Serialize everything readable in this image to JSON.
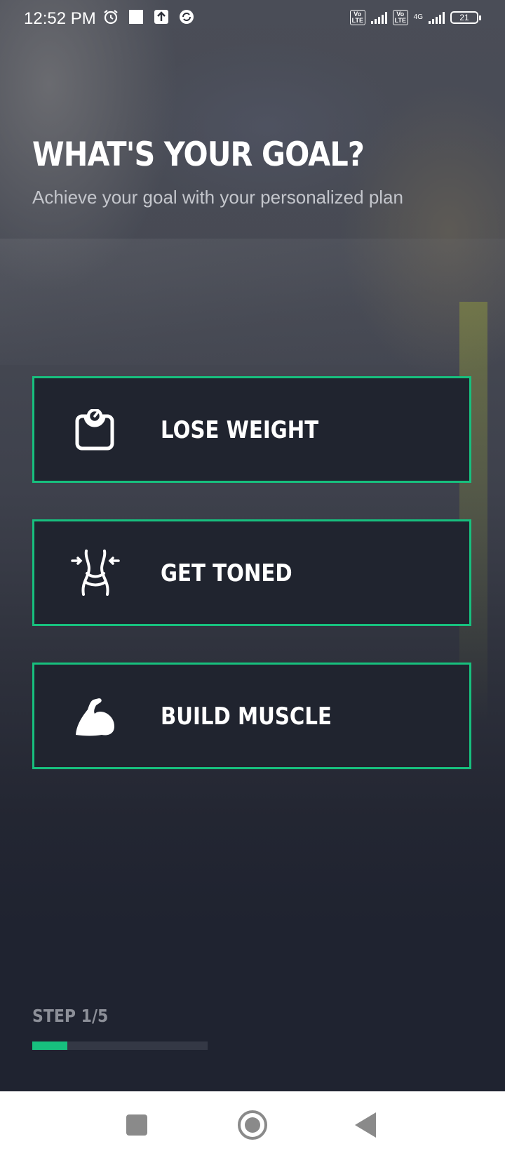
{
  "status_bar": {
    "time": "12:52 PM",
    "left_icons": [
      "alarm-icon",
      "square-notification-icon",
      "upload-icon",
      "sync-icon"
    ],
    "volte_1": "Vo LTE",
    "volte_2": "Vo LTE",
    "network_type": "4G",
    "battery": "21"
  },
  "header": {
    "title": "WHAT'S YOUR GOAL?",
    "subtitle": "Achieve your goal with your personalized plan"
  },
  "goals": [
    {
      "label": "LOSE WEIGHT",
      "icon": "scale-icon"
    },
    {
      "label": "GET TONED",
      "icon": "waist-icon"
    },
    {
      "label": "BUILD MUSCLE",
      "icon": "flexed-bicep-icon"
    }
  ],
  "progress": {
    "step_label": "STEP 1/5",
    "fraction": 0.2
  },
  "colors": {
    "accent": "#17c07e",
    "card_background": "#20242f",
    "page_background": "#1f2330"
  },
  "nav_bar": {
    "buttons": [
      "recents-square-icon",
      "home-circle-icon",
      "back-triangle-icon"
    ]
  }
}
